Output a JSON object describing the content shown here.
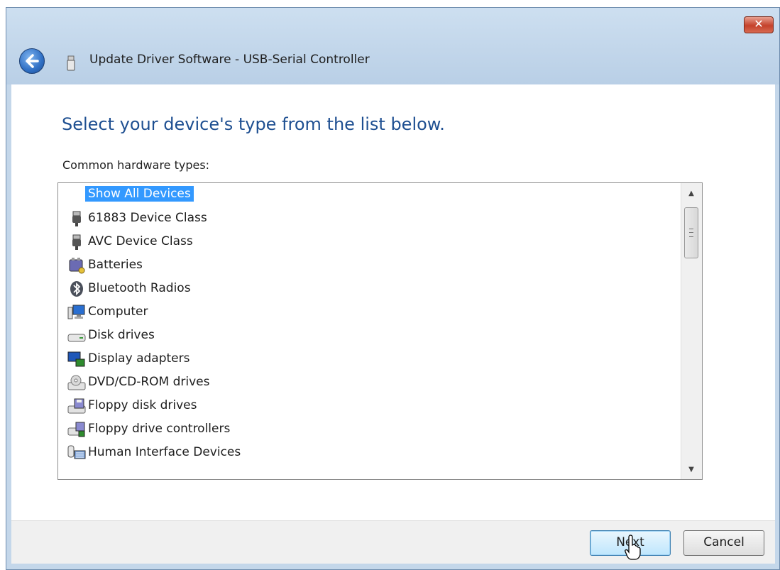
{
  "window": {
    "title": "Update Driver Software - USB-Serial Controller",
    "close_symbol": "✕"
  },
  "main": {
    "heading": "Select your device's type from the list below.",
    "list_label": "Common hardware types:",
    "items": [
      {
        "label": "Show All Devices",
        "icon": "none",
        "selected": true
      },
      {
        "label": "61883 Device Class",
        "icon": "usb-plug-icon"
      },
      {
        "label": "AVC Device Class",
        "icon": "usb-plug-icon"
      },
      {
        "label": "Batteries",
        "icon": "battery-icon"
      },
      {
        "label": "Bluetooth Radios",
        "icon": "bluetooth-icon"
      },
      {
        "label": "Computer",
        "icon": "computer-icon"
      },
      {
        "label": "Disk drives",
        "icon": "disk-drive-icon"
      },
      {
        "label": "Display adapters",
        "icon": "display-adapter-icon"
      },
      {
        "label": "DVD/CD-ROM drives",
        "icon": "dvd-drive-icon"
      },
      {
        "label": "Floppy disk drives",
        "icon": "floppy-drive-icon"
      },
      {
        "label": "Floppy drive controllers",
        "icon": "floppy-controller-icon"
      },
      {
        "label": "Human Interface Devices",
        "icon": "hid-icon"
      }
    ]
  },
  "footer": {
    "next_label": "Next",
    "cancel_label": "Cancel"
  },
  "colors": {
    "heading": "#1e4f91",
    "selection": "#3399ff",
    "title_bar": "#c4d7ea"
  }
}
